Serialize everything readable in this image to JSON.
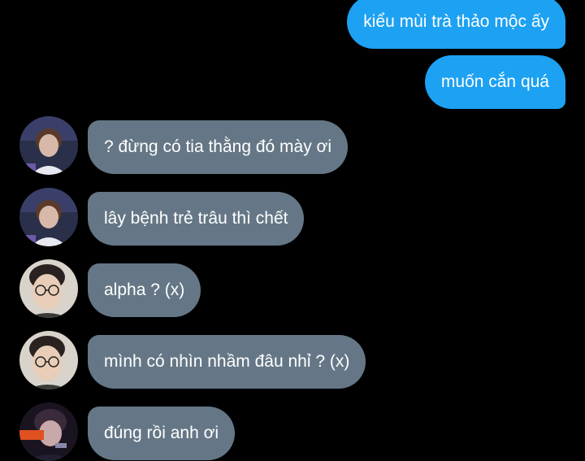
{
  "conversation": {
    "sent": [
      {
        "text": "kiểu mùi trà thảo mộc ấy"
      },
      {
        "text": "muốn cắn quá"
      }
    ],
    "received": [
      {
        "text": "? đừng có tia thằng đó mày ơi",
        "avatar": "user-a-avatar"
      },
      {
        "text": "lây bệnh trẻ trâu thì chết",
        "avatar": "user-a-avatar"
      },
      {
        "text": "alpha ? (x)",
        "avatar": "user-b-avatar"
      },
      {
        "text": "mình có nhìn nhầm đâu nhỉ ? (x)",
        "avatar": "user-b-avatar"
      },
      {
        "text": "đúng rồi anh ơi",
        "avatar": "user-c-avatar"
      }
    ]
  },
  "colors": {
    "background": "#000000",
    "sent_bubble": "#1da1f2",
    "received_bubble": "#657786",
    "text": "#ffffff"
  }
}
